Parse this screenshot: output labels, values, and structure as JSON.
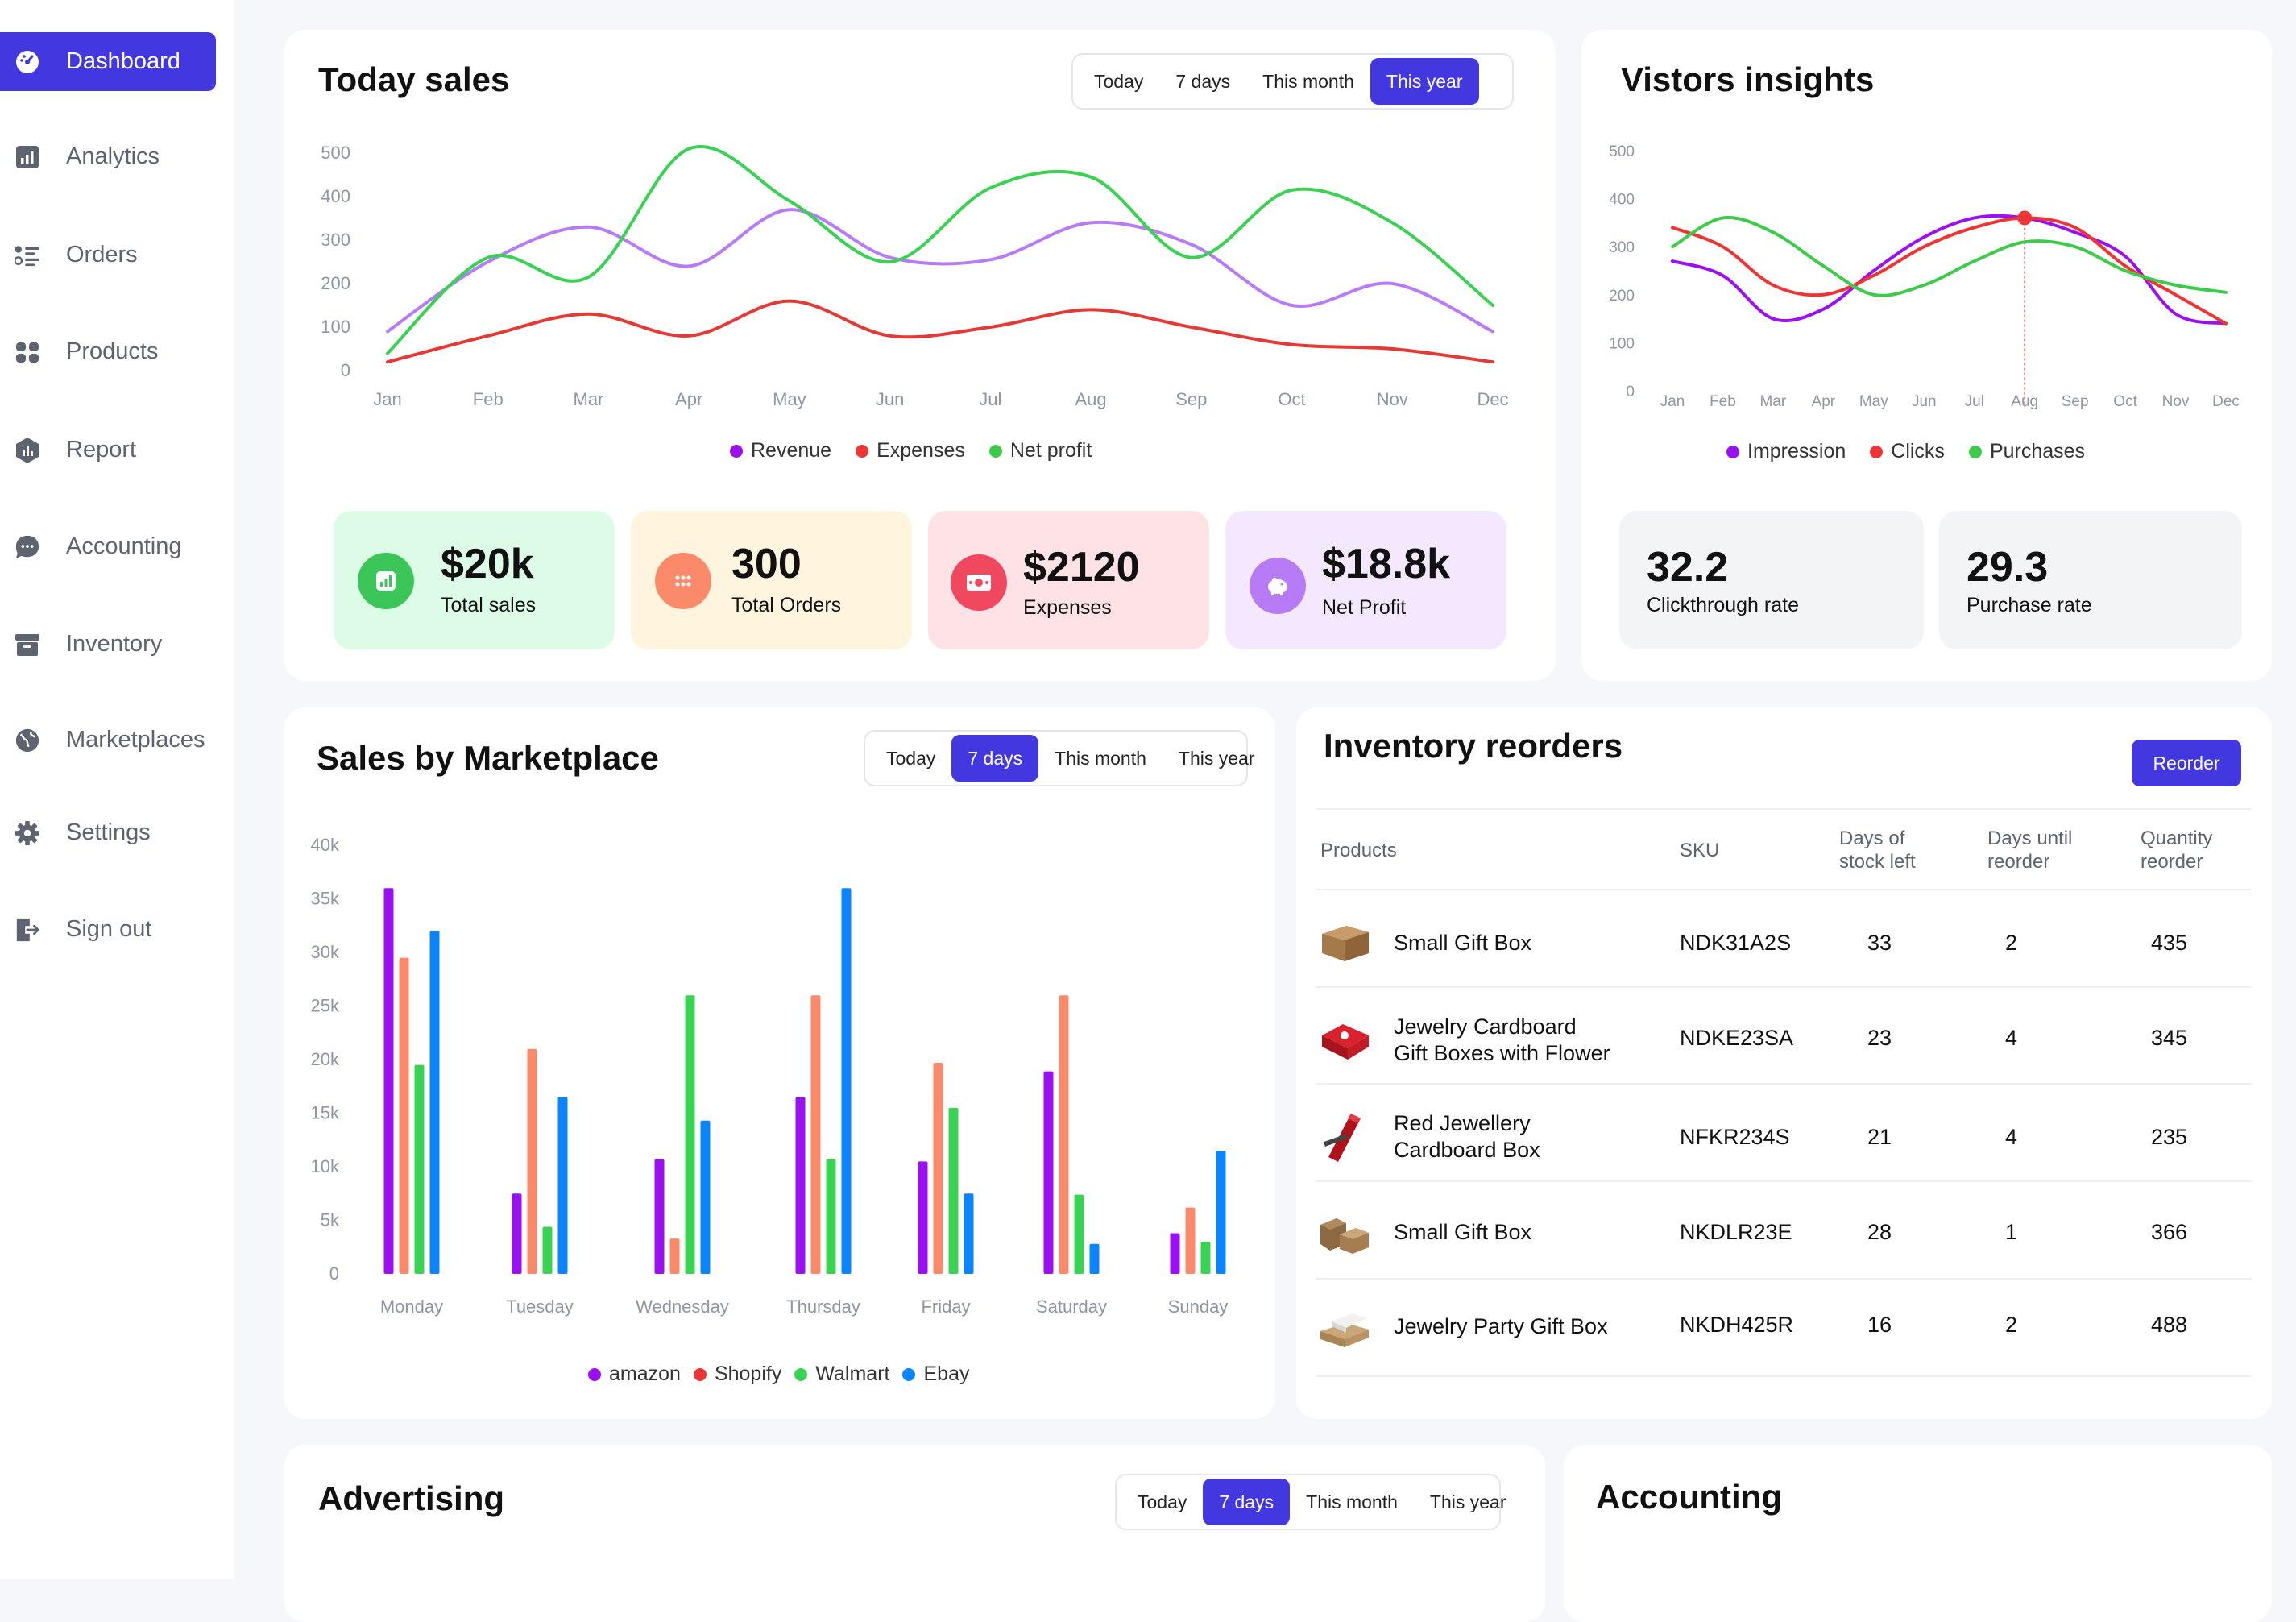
{
  "sidebar": {
    "items": [
      {
        "label": "Dashboard",
        "icon": "dashboard-gauge-icon",
        "active": true
      },
      {
        "label": "Analytics",
        "icon": "bar-chart-icon"
      },
      {
        "label": "Orders",
        "icon": "list-icon"
      },
      {
        "label": "Products",
        "icon": "grid-dots-icon"
      },
      {
        "label": "Report",
        "icon": "shield-chart-icon"
      },
      {
        "label": "Accounting",
        "icon": "chat-bubble-icon"
      },
      {
        "label": "Inventory",
        "icon": "archive-box-icon"
      },
      {
        "label": "Marketplaces",
        "icon": "globe-icon"
      },
      {
        "label": "Settings",
        "icon": "gear-icon"
      },
      {
        "label": "Sign out",
        "icon": "sign-out-icon"
      }
    ]
  },
  "today_sales": {
    "title": "Today sales",
    "filters": [
      "Today",
      "7 days",
      "This month",
      "This year"
    ],
    "active_filter": "This year",
    "legend": [
      "Revenue",
      "Expenses",
      "Net profit"
    ],
    "stats": [
      {
        "value": "$20k",
        "label": "Total sales",
        "icon": "chart-up-icon",
        "color": "#3cc65a"
      },
      {
        "value": "300",
        "label": "Total Orders",
        "icon": "dots-grid-icon",
        "color": "#fb8a6b"
      },
      {
        "value": "$2120",
        "label": "Expenses",
        "icon": "cash-icon",
        "color": "#f0485f"
      },
      {
        "value": "$18.8k",
        "label": "Net Profit",
        "icon": "piggy-bank-icon",
        "color": "#b77cf5"
      }
    ]
  },
  "visitors": {
    "title": "Vistors insights",
    "legend": [
      "Impression",
      "Clicks",
      "Purchases"
    ],
    "stats": [
      {
        "value": "32.2",
        "label": "Clickthrough rate"
      },
      {
        "value": "29.3",
        "label": "Purchase rate"
      }
    ]
  },
  "marketplace": {
    "title": "Sales by Marketplace",
    "filters": [
      "Today",
      "7 days",
      "This month",
      "This year"
    ],
    "active_filter": "7 days",
    "legend": [
      "amazon",
      "Shopify",
      "Walmart",
      "Ebay"
    ]
  },
  "inventory": {
    "title": "Inventory reorders",
    "reorder_label": "Reorder",
    "headers": {
      "products": "Products",
      "sku": "SKU",
      "days_stock_1": "Days of",
      "days_stock_2": "stock left",
      "days_until_1": "Days until",
      "days_until_2": "reorder",
      "qty_1": "Quantity",
      "qty_2": "reorder"
    },
    "rows": [
      {
        "name1": "Small Gift Box",
        "name2": "",
        "sku": "NDK31A2S",
        "days": "33",
        "until": "2",
        "qty": "435",
        "thumb": "cardboard-box-icon"
      },
      {
        "name1": "Jewelry Cardboard",
        "name2": "Gift Boxes with Flower",
        "sku": "NDKE23SA",
        "days": "23",
        "until": "4",
        "qty": "345",
        "thumb": "red-gift-box-icon"
      },
      {
        "name1": "Red Jewellery",
        "name2": "Cardboard Box",
        "sku": "NFKR234S",
        "days": "21",
        "until": "4",
        "qty": "235",
        "thumb": "red-long-box-icon"
      },
      {
        "name1": "Small Gift Box",
        "name2": "",
        "sku": "NKDLR23E",
        "days": "28",
        "until": "1",
        "qty": "366",
        "thumb": "kraft-boxes-icon"
      },
      {
        "name1": "Jewelry Party Gift Box",
        "name2": "",
        "sku": "NKDH425R",
        "days": "16",
        "until": "2",
        "qty": "488",
        "thumb": "white-kraft-box-icon"
      }
    ]
  },
  "advertising": {
    "title": "Advertising",
    "filters": [
      "Today",
      "7 days",
      "This month",
      "This year"
    ],
    "active_filter": "7 days"
  },
  "accounting": {
    "title": "Accounting"
  },
  "colors": {
    "accent": "#4338e0",
    "revenue": "#b77cf5",
    "expenses": "#e53935",
    "net_profit": "#3ad154",
    "impression": "#9b10f0",
    "clicks": "#ee3535",
    "purchases": "#3ecb4c",
    "amazon": "#9b10f0",
    "shopify": "#fb8a6b",
    "walmart": "#39d353",
    "ebay": "#0a84ff"
  },
  "chart_data": [
    {
      "type": "line",
      "title": "Today sales",
      "x": [
        "Jan",
        "Feb",
        "Mar",
        "Apr",
        "May",
        "Jun",
        "Jul",
        "Aug",
        "Sep",
        "Oct",
        "Nov",
        "Dec"
      ],
      "ylim": [
        0,
        500
      ],
      "yticks": [
        0,
        100,
        200,
        300,
        400,
        500
      ],
      "series": [
        {
          "name": "Revenue",
          "values": [
            90,
            250,
            330,
            240,
            370,
            260,
            255,
            340,
            290,
            150,
            200,
            90
          ]
        },
        {
          "name": "Expenses",
          "values": [
            20,
            80,
            130,
            80,
            160,
            80,
            100,
            140,
            100,
            60,
            50,
            20
          ]
        },
        {
          "name": "Net profit",
          "values": [
            40,
            260,
            215,
            510,
            390,
            250,
            420,
            445,
            260,
            415,
            340,
            150
          ]
        }
      ]
    },
    {
      "type": "line",
      "title": "Vistors insights",
      "x": [
        "Jan",
        "Feb",
        "Mar",
        "Apr",
        "May",
        "Jun",
        "Jul",
        "Aug",
        "Sep",
        "Oct",
        "Nov",
        "Dec"
      ],
      "ylim": [
        0,
        500
      ],
      "yticks": [
        0,
        100,
        200,
        300,
        400,
        500
      ],
      "highlight_x": "Aug",
      "series": [
        {
          "name": "Impression",
          "values": [
            270,
            240,
            150,
            170,
            250,
            320,
            360,
            360,
            330,
            280,
            160,
            140
          ]
        },
        {
          "name": "Clicks",
          "values": [
            340,
            300,
            220,
            200,
            240,
            300,
            340,
            360,
            340,
            260,
            200,
            140
          ]
        },
        {
          "name": "Purchases",
          "values": [
            300,
            360,
            330,
            260,
            200,
            220,
            270,
            310,
            300,
            250,
            220,
            205
          ]
        }
      ]
    },
    {
      "type": "bar",
      "title": "Sales by Marketplace",
      "categories": [
        "Monday",
        "Tuesday",
        "Wednesday",
        "Thursday",
        "Friday",
        "Saturday",
        "Sunday"
      ],
      "ylim": [
        0,
        40000
      ],
      "yticks": [
        "0",
        "5k",
        "10k",
        "15k",
        "20k",
        "25k",
        "30k",
        "35k",
        "40k"
      ],
      "series": [
        {
          "name": "amazon",
          "values": [
            36000,
            7500,
            10700,
            16500,
            10500,
            18900,
            3800
          ]
        },
        {
          "name": "Shopify",
          "values": [
            29500,
            21000,
            3300,
            26000,
            19700,
            26000,
            6200
          ]
        },
        {
          "name": "Walmart",
          "values": [
            19500,
            4400,
            26000,
            10700,
            15500,
            7400,
            3000
          ]
        },
        {
          "name": "Ebay",
          "values": [
            32000,
            16500,
            14300,
            36000,
            7500,
            2800,
            11500
          ]
        }
      ]
    }
  ]
}
